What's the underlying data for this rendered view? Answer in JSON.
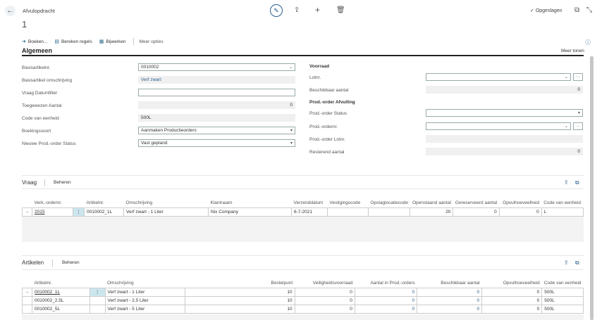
{
  "header": {
    "title": "Afvulopdracht",
    "number": "1",
    "saved": "Opgeslagen"
  },
  "actions": {
    "post": "Boeken...",
    "calc": "Bereken regels",
    "update": "Bijwerken",
    "more": "Meer opties"
  },
  "general": {
    "title": "Algemeen",
    "more_fields": "Meer tonen",
    "fields": {
      "base_item": {
        "label": "Basisartikelnr.",
        "value": "0010002"
      },
      "base_desc": {
        "label": "Basisartikel omschrijving",
        "value": "Verf zwart"
      },
      "demand_filter": {
        "label": "Vraag Datumfilter",
        "value": ""
      },
      "assigned_qty": {
        "label": "Toegewezen Aantal",
        "value": "0"
      },
      "uom": {
        "label": "Code van eenheid",
        "value": "500L"
      },
      "posting_type": {
        "label": "Boekingssoort",
        "value": "Aanmaken Productieorders"
      },
      "new_status": {
        "label": "Nieuwe Prod.-order Status",
        "value": "Vast gepland"
      }
    },
    "inventory": {
      "title": "Voorraad",
      "lot_label": "Lotnr.",
      "lot_value": "",
      "avail_label": "Beschikbaar aantal",
      "avail_value": "0"
    },
    "prod": {
      "title": "Prod.-order Afvulling",
      "status_label": "Prod.-order Status",
      "status_value": "",
      "no_label": "Prod.-ordernr.",
      "no_value": "",
      "lot_label": "Prod.-order Lotnr.",
      "lot_value": "",
      "remain_label": "Resterend aantal",
      "remain_value": "0"
    }
  },
  "demand": {
    "title": "Vraag",
    "manage": "Beheren",
    "columns": [
      "Verk.-ordernr.",
      "Artikelnr.",
      "Omschrijving",
      "Klantnaam",
      "Verzenddatum",
      "Vestigingscode",
      "Opslaglocatiecode",
      "Openstaand aantal",
      "Gereserveerd aantal",
      "Opvulhoeveelheid",
      "Code van eenheid"
    ],
    "rows": [
      [
        "2015",
        "0010002_1L",
        "Verf zwart - 1 Liter",
        "Nix Company",
        "6-7-2021",
        "",
        "",
        "20",
        "0",
        "0",
        "L"
      ]
    ]
  },
  "items": {
    "title": "Artikelen",
    "manage": "Beheren",
    "columns": [
      "Artikelnr.",
      "Omschrijving",
      "Bestelpunt",
      "Veiligheidsvoorraad",
      "Aantal in Prod.-orders",
      "Beschikbaar aantal",
      "Opvulhoeveelheid",
      "Code van eenheid"
    ],
    "rows": [
      [
        "0010002_1L",
        "Verf zwart - 1 Liter",
        "10",
        "0",
        "0",
        "0",
        "0",
        "500L"
      ],
      [
        "0010002_2.5L",
        "Verf zwart - 2.5 Liter",
        "10",
        "0",
        "0",
        "0",
        "0",
        "500L"
      ],
      [
        "0010002_5L",
        "Verf zwart - 5 Liter",
        "10",
        "0",
        "0",
        "0",
        "0",
        "500L"
      ]
    ]
  }
}
